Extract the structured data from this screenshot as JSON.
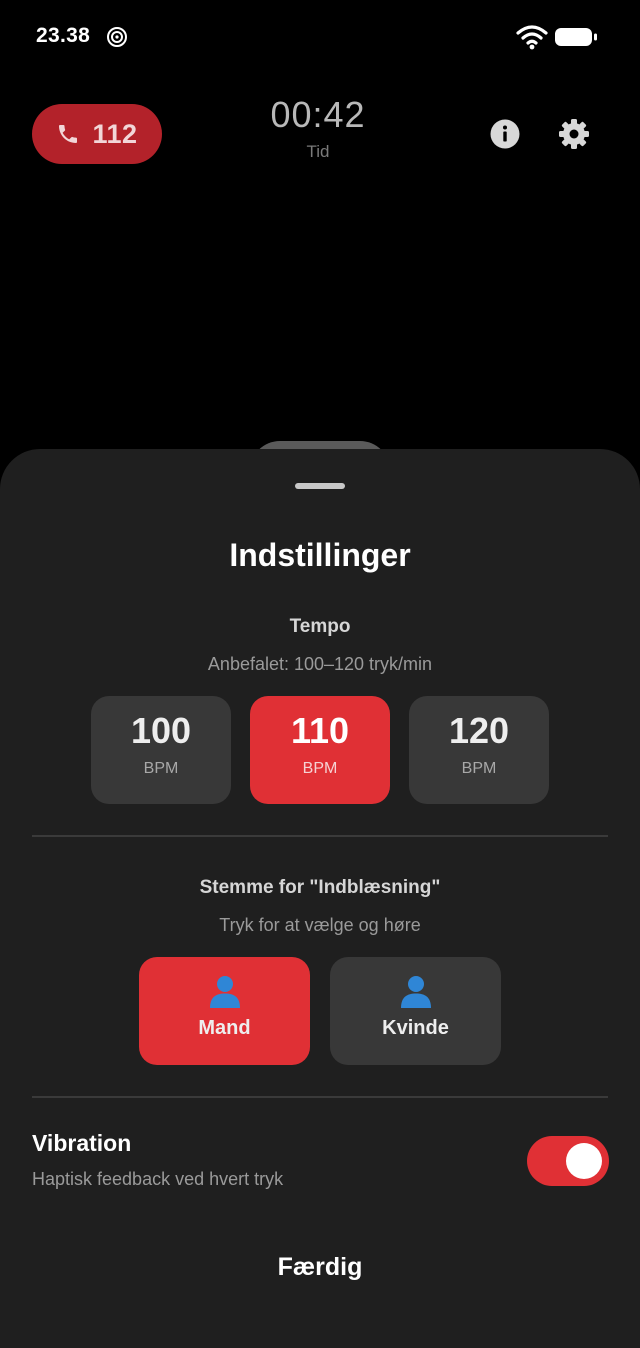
{
  "status_bar": {
    "time": "23.38",
    "icons": [
      "app-notification-icon",
      "wifi-icon",
      "battery-icon"
    ]
  },
  "header": {
    "call_label": "112",
    "call_icon": "phone-icon",
    "timer_value": "00:42",
    "timer_label": "Tid",
    "info_icon": "info-icon",
    "settings_icon": "gear-icon"
  },
  "settings_sheet": {
    "title": "Indstillinger",
    "tempo": {
      "title": "Tempo",
      "subtitle": "Anbefalet: 100–120 tryk/min",
      "options": [
        {
          "value": "100",
          "unit": "BPM",
          "selected": false
        },
        {
          "value": "110",
          "unit": "BPM",
          "selected": true
        },
        {
          "value": "120",
          "unit": "BPM",
          "selected": false
        }
      ]
    },
    "voice": {
      "title": "Stemme for \"Indblæsning\"",
      "subtitle": "Tryk for at vælge og høre",
      "options": [
        {
          "label": "Mand",
          "icon": "person-icon",
          "selected": true
        },
        {
          "label": "Kvinde",
          "icon": "person-icon",
          "selected": false
        }
      ]
    },
    "vibration": {
      "title": "Vibration",
      "subtitle": "Haptisk feedback ved hvert tryk",
      "enabled": true
    },
    "done_label": "Færdig"
  },
  "colors": {
    "accent_red": "#e03035",
    "call_red": "#b3222a",
    "sheet_bg": "#1f1f1f",
    "option_bg": "#383838",
    "person_icon_blue": "#2f86d6"
  }
}
